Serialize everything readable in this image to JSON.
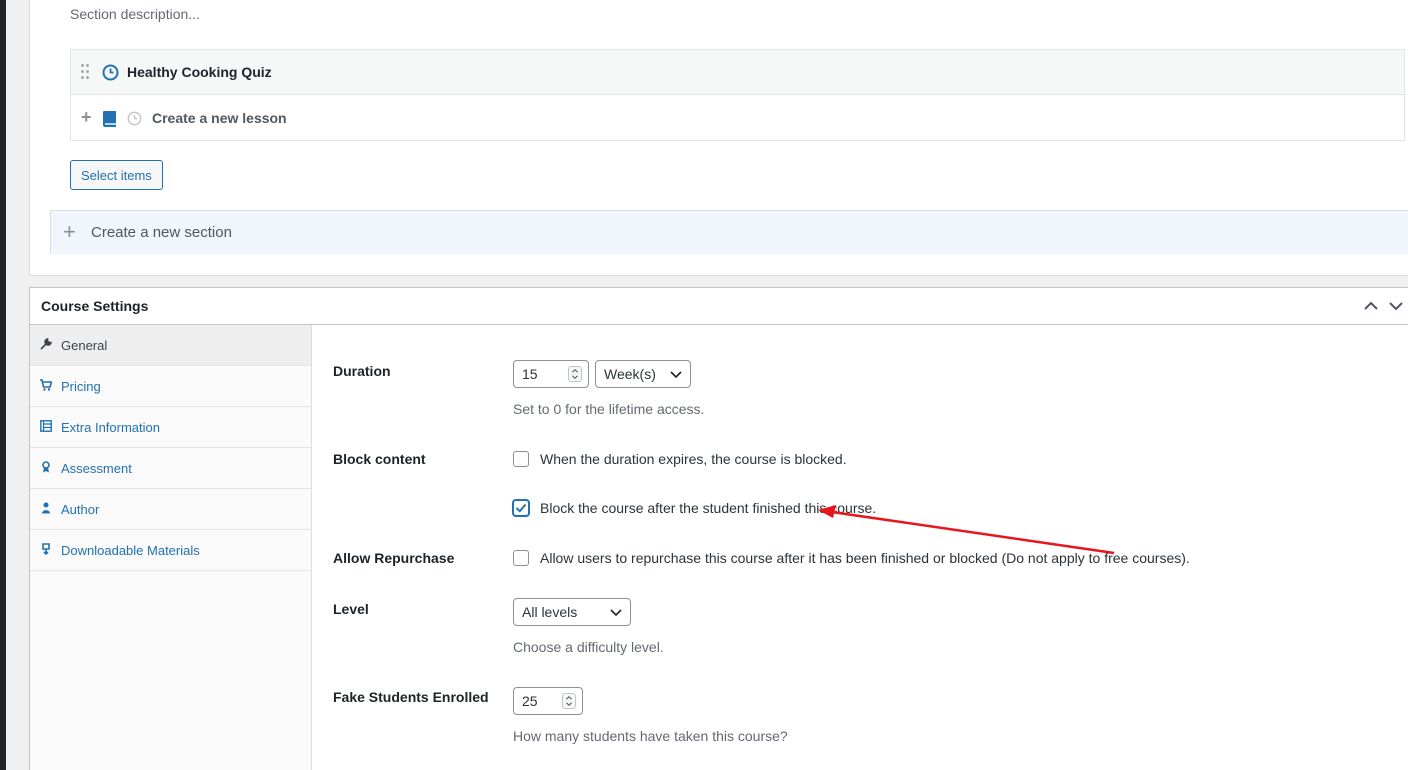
{
  "curriculum": {
    "section_description_placeholder": "Section description...",
    "items": [
      {
        "title": "Healthy Cooking Quiz",
        "type": "quiz"
      },
      {
        "title": "Create a new lesson",
        "type": "new-lesson"
      }
    ],
    "select_items_label": "Select items",
    "new_section_placeholder": "Create a new section"
  },
  "settings": {
    "title": "Course Settings",
    "tabs": [
      {
        "label": "General",
        "icon": "wrench-icon"
      },
      {
        "label": "Pricing",
        "icon": "cart-icon"
      },
      {
        "label": "Extra Information",
        "icon": "info-icon"
      },
      {
        "label": "Assessment",
        "icon": "award-icon"
      },
      {
        "label": "Author",
        "icon": "user-icon"
      },
      {
        "label": "Downloadable Materials",
        "icon": "download-icon"
      }
    ],
    "duration": {
      "label": "Duration",
      "value": "15",
      "unit": "Week(s)",
      "hint": "Set to 0 for the lifetime access."
    },
    "block_content": {
      "label": "Block content",
      "option1": "When the duration expires, the course is blocked.",
      "option1_checked": false,
      "option2": "Block the course after the student finished this course.",
      "option2_checked": true
    },
    "allow_repurchase": {
      "label": "Allow Repurchase",
      "option": "Allow users to repurchase this course after it has been finished or blocked (Do not apply to free courses).",
      "checked": false
    },
    "level": {
      "label": "Level",
      "value": "All levels",
      "hint": "Choose a difficulty level."
    },
    "fake_students": {
      "label": "Fake Students Enrolled",
      "value": "25",
      "hint": "How many students have taken this course?"
    }
  },
  "colors": {
    "accent": "#2271b1",
    "annotation_arrow": "#e8161c"
  }
}
